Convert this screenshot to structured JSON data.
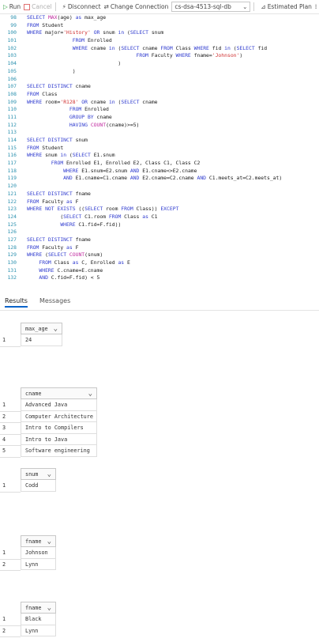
{
  "toolbar": {
    "run_label": "Run",
    "cancel_label": "Cancel",
    "disconnect_label": "Disconnect",
    "change_connection_label": "Change Connection",
    "database_value": "cs-dsa-4513-sql-db",
    "estimated_plan_label": "Estimated Plan"
  },
  "editor": {
    "lines": [
      {
        "n": "98",
        "segs": [
          [
            "kw",
            "SELECT "
          ],
          [
            "fn",
            "MAX"
          ],
          [
            "code",
            "(age) "
          ],
          [
            "kw",
            "as"
          ],
          [
            "code",
            " max_age"
          ]
        ]
      },
      {
        "n": "99",
        "segs": [
          [
            "kw",
            "FROM"
          ],
          [
            "code",
            " Student"
          ]
        ]
      },
      {
        "n": "100",
        "segs": [
          [
            "kw",
            "WHERE"
          ],
          [
            "code",
            " major="
          ],
          [
            "str",
            "'History'"
          ],
          [
            "code",
            " "
          ],
          [
            "kw",
            "OR"
          ],
          [
            "code",
            " snum "
          ],
          [
            "kw",
            "in"
          ],
          [
            "code",
            " ("
          ],
          [
            "kw",
            "SELECT"
          ],
          [
            "code",
            " snum"
          ]
        ]
      },
      {
        "n": "101",
        "segs": [
          [
            "code",
            "               "
          ],
          [
            "kw",
            "FROM"
          ],
          [
            "code",
            " Enrolled"
          ]
        ]
      },
      {
        "n": "102",
        "segs": [
          [
            "code",
            "               "
          ],
          [
            "kw",
            "WHERE"
          ],
          [
            "code",
            " cname "
          ],
          [
            "kw",
            "in"
          ],
          [
            "code",
            " ("
          ],
          [
            "kw",
            "SELECT"
          ],
          [
            "code",
            " cname "
          ],
          [
            "kw",
            "FROM"
          ],
          [
            "code",
            " Class "
          ],
          [
            "kw",
            "WHERE"
          ],
          [
            "code",
            " fid "
          ],
          [
            "kw",
            "in"
          ],
          [
            "code",
            " ("
          ],
          [
            "kw",
            "SELECT"
          ],
          [
            "code",
            " fid"
          ]
        ]
      },
      {
        "n": "103",
        "segs": [
          [
            "code",
            "                                    "
          ],
          [
            "kw",
            "FROM"
          ],
          [
            "code",
            " Faculty "
          ],
          [
            "kw",
            "WHERE"
          ],
          [
            "code",
            " fname="
          ],
          [
            "str",
            "'Johnson'"
          ],
          [
            "code",
            ")"
          ]
        ]
      },
      {
        "n": "104",
        "segs": [
          [
            "code",
            "                              )"
          ]
        ]
      },
      {
        "n": "105",
        "segs": [
          [
            "code",
            "               )"
          ]
        ]
      },
      {
        "n": "106",
        "segs": [
          [
            "code",
            ""
          ]
        ]
      },
      {
        "n": "107",
        "segs": [
          [
            "kw",
            "SELECT DISTINCT"
          ],
          [
            "code",
            " cname"
          ]
        ]
      },
      {
        "n": "108",
        "segs": [
          [
            "kw",
            "FROM"
          ],
          [
            "code",
            " Class"
          ]
        ]
      },
      {
        "n": "109",
        "segs": [
          [
            "kw",
            "WHERE"
          ],
          [
            "code",
            " room="
          ],
          [
            "str",
            "'R128'"
          ],
          [
            "code",
            " "
          ],
          [
            "kw",
            "OR"
          ],
          [
            "code",
            " cname "
          ],
          [
            "kw",
            "in"
          ],
          [
            "code",
            " ("
          ],
          [
            "kw",
            "SELECT"
          ],
          [
            "code",
            " cname"
          ]
        ]
      },
      {
        "n": "110",
        "segs": [
          [
            "code",
            "              "
          ],
          [
            "kw",
            "FROM"
          ],
          [
            "code",
            " Enrolled"
          ]
        ]
      },
      {
        "n": "111",
        "segs": [
          [
            "code",
            "              "
          ],
          [
            "kw",
            "GROUP BY"
          ],
          [
            "code",
            " cname"
          ]
        ]
      },
      {
        "n": "112",
        "segs": [
          [
            "code",
            "              "
          ],
          [
            "kw",
            "HAVING"
          ],
          [
            "code",
            " "
          ],
          [
            "fn",
            "COUNT"
          ],
          [
            "code",
            "(cname)>=5)"
          ]
        ]
      },
      {
        "n": "113",
        "segs": [
          [
            "code",
            ""
          ]
        ]
      },
      {
        "n": "114",
        "segs": [
          [
            "kw",
            "SELECT DISTINCT"
          ],
          [
            "code",
            " snum"
          ]
        ]
      },
      {
        "n": "115",
        "segs": [
          [
            "kw",
            "FROM"
          ],
          [
            "code",
            " Student"
          ]
        ]
      },
      {
        "n": "116",
        "segs": [
          [
            "kw",
            "WHERE"
          ],
          [
            "code",
            " snum "
          ],
          [
            "kw",
            "in"
          ],
          [
            "code",
            " ("
          ],
          [
            "kw",
            "SELECT"
          ],
          [
            "code",
            " E1.snum"
          ]
        ]
      },
      {
        "n": "117",
        "segs": [
          [
            "code",
            "        "
          ],
          [
            "kw",
            "FROM"
          ],
          [
            "code",
            " Enrolled E1, Enrolled E2, Class C1, Class C2"
          ]
        ]
      },
      {
        "n": "118",
        "segs": [
          [
            "code",
            "            "
          ],
          [
            "kw",
            "WHERE"
          ],
          [
            "code",
            " E1.snum=E2.snum "
          ],
          [
            "kw",
            "AND"
          ],
          [
            "code",
            " E1.cname<>E2.cname"
          ]
        ]
      },
      {
        "n": "119",
        "segs": [
          [
            "code",
            "            "
          ],
          [
            "kw",
            "AND"
          ],
          [
            "code",
            " E1.cname=C1.cname "
          ],
          [
            "kw",
            "AND"
          ],
          [
            "code",
            " E2.cname=C2.cname "
          ],
          [
            "kw",
            "AND"
          ],
          [
            "code",
            " C1.meets_at=C2.meets_at)"
          ]
        ]
      },
      {
        "n": "120",
        "segs": [
          [
            "code",
            ""
          ]
        ]
      },
      {
        "n": "121",
        "segs": [
          [
            "kw",
            "SELECT DISTINCT"
          ],
          [
            "code",
            " fname"
          ]
        ]
      },
      {
        "n": "122",
        "segs": [
          [
            "kw",
            "FROM"
          ],
          [
            "code",
            " Faculty "
          ],
          [
            "kw",
            "as"
          ],
          [
            "code",
            " F"
          ]
        ]
      },
      {
        "n": "123",
        "segs": [
          [
            "kw",
            "WHERE NOT EXISTS"
          ],
          [
            "code",
            " (("
          ],
          [
            "kw",
            "SELECT"
          ],
          [
            "code",
            " room "
          ],
          [
            "kw",
            "FROM"
          ],
          [
            "code",
            " Class)) "
          ],
          [
            "kw",
            "EXCEPT"
          ]
        ]
      },
      {
        "n": "124",
        "segs": [
          [
            "code",
            "           ("
          ],
          [
            "kw",
            "SELECT"
          ],
          [
            "code",
            " C1.room "
          ],
          [
            "kw",
            "FROM"
          ],
          [
            "code",
            " Class "
          ],
          [
            "kw",
            "as"
          ],
          [
            "code",
            " C1"
          ]
        ]
      },
      {
        "n": "125",
        "segs": [
          [
            "code",
            "           "
          ],
          [
            "kw",
            "WHERE"
          ],
          [
            "code",
            " C1.fid=F.fid))"
          ]
        ]
      },
      {
        "n": "126",
        "segs": [
          [
            "code",
            ""
          ]
        ]
      },
      {
        "n": "127",
        "segs": [
          [
            "kw",
            "SELECT DISTINCT"
          ],
          [
            "code",
            " fname"
          ]
        ]
      },
      {
        "n": "128",
        "segs": [
          [
            "kw",
            "FROM"
          ],
          [
            "code",
            " Faculty "
          ],
          [
            "kw",
            "as"
          ],
          [
            "code",
            " F"
          ]
        ]
      },
      {
        "n": "129",
        "segs": [
          [
            "kw",
            "WHERE"
          ],
          [
            "code",
            " ("
          ],
          [
            "kw",
            "SELECT"
          ],
          [
            "code",
            " "
          ],
          [
            "fn",
            "COUNT"
          ],
          [
            "code",
            "(snum)"
          ]
        ]
      },
      {
        "n": "130",
        "segs": [
          [
            "code",
            "    "
          ],
          [
            "kw",
            "FROM"
          ],
          [
            "code",
            " Class "
          ],
          [
            "kw",
            "as"
          ],
          [
            "code",
            " C, Enrolled "
          ],
          [
            "kw",
            "as"
          ],
          [
            "code",
            " E"
          ]
        ]
      },
      {
        "n": "131",
        "segs": [
          [
            "code",
            "    "
          ],
          [
            "kw",
            "WHERE"
          ],
          [
            "code",
            " C.cname=E.cname"
          ]
        ]
      },
      {
        "n": "132",
        "segs": [
          [
            "code",
            "    "
          ],
          [
            "kw",
            "AND"
          ],
          [
            "code",
            " C.fid=F.fid) < 5"
          ]
        ]
      }
    ]
  },
  "tabs": {
    "results_label": "Results",
    "messages_label": "Messages"
  },
  "grids": [
    {
      "header": "max_age",
      "rows": [
        [
          "1",
          "24"
        ]
      ]
    },
    {
      "header": "cname",
      "rows": [
        [
          "1",
          "Advanced Java"
        ],
        [
          "2",
          "Computer Architecture"
        ],
        [
          "3",
          "Intro to Compilers"
        ],
        [
          "4",
          "Intro to Java"
        ],
        [
          "5",
          "Software engineering"
        ]
      ]
    },
    {
      "header": "snum",
      "rows": [
        [
          "1",
          "Codd"
        ]
      ]
    },
    {
      "header": "fname",
      "rows": [
        [
          "1",
          "Johnson"
        ],
        [
          "2",
          "Lynn"
        ]
      ]
    },
    {
      "header": "fname",
      "rows": [
        [
          "1",
          "Black"
        ],
        [
          "2",
          "Lynn"
        ]
      ]
    }
  ]
}
